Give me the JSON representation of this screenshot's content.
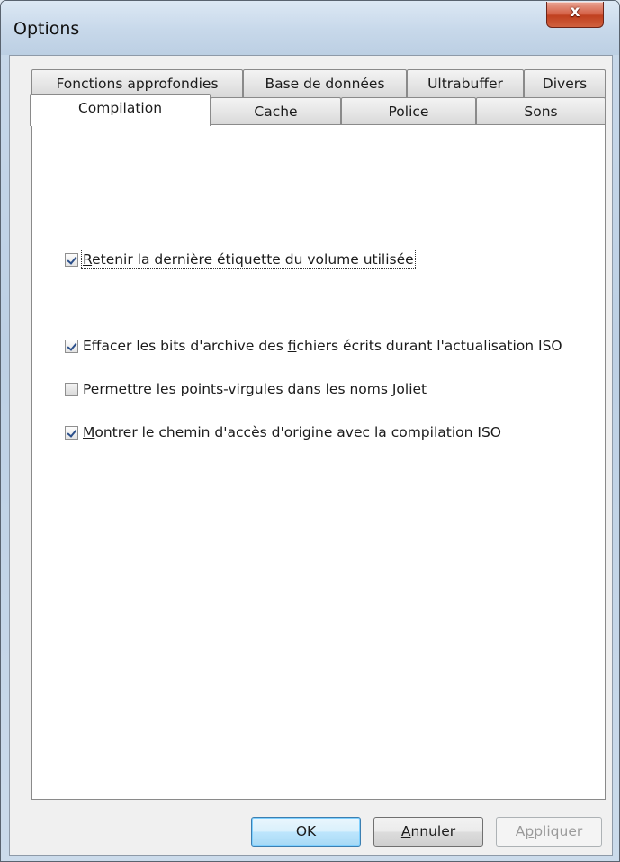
{
  "window": {
    "title": "Options",
    "close_glyph": "x"
  },
  "tabs_back": [
    "Fonctions approfondies",
    "Base de données",
    "Ultrabuffer",
    "Divers"
  ],
  "tabs_front": [
    "Compilation",
    "Cache",
    "Police",
    "Sons"
  ],
  "active_tab": "Compilation",
  "options": [
    {
      "pre": "",
      "acc": "R",
      "post": "etenir la dernière étiquette du volume utilisée",
      "checked": true
    },
    {
      "pre": "Effacer les bits d'archive des ",
      "acc": "f",
      "post": "ichiers écrits durant l'actualisation ISO",
      "checked": true
    },
    {
      "pre": "P",
      "acc": "e",
      "post": "rmettre les points-virgules dans les noms Joliet",
      "checked": false
    },
    {
      "pre": "",
      "acc": "M",
      "post": "ontrer le chemin d'accès d'origine avec la compilation ISO",
      "checked": true
    }
  ],
  "buttons": {
    "ok": "OK",
    "cancel_acc": "A",
    "cancel_rest": "nnuler",
    "apply_pre": "A",
    "apply_acc": "p",
    "apply_rest": "pliquer"
  },
  "icons": {
    "checkbox_checked": "checkmark-icon",
    "close": "close-icon"
  }
}
